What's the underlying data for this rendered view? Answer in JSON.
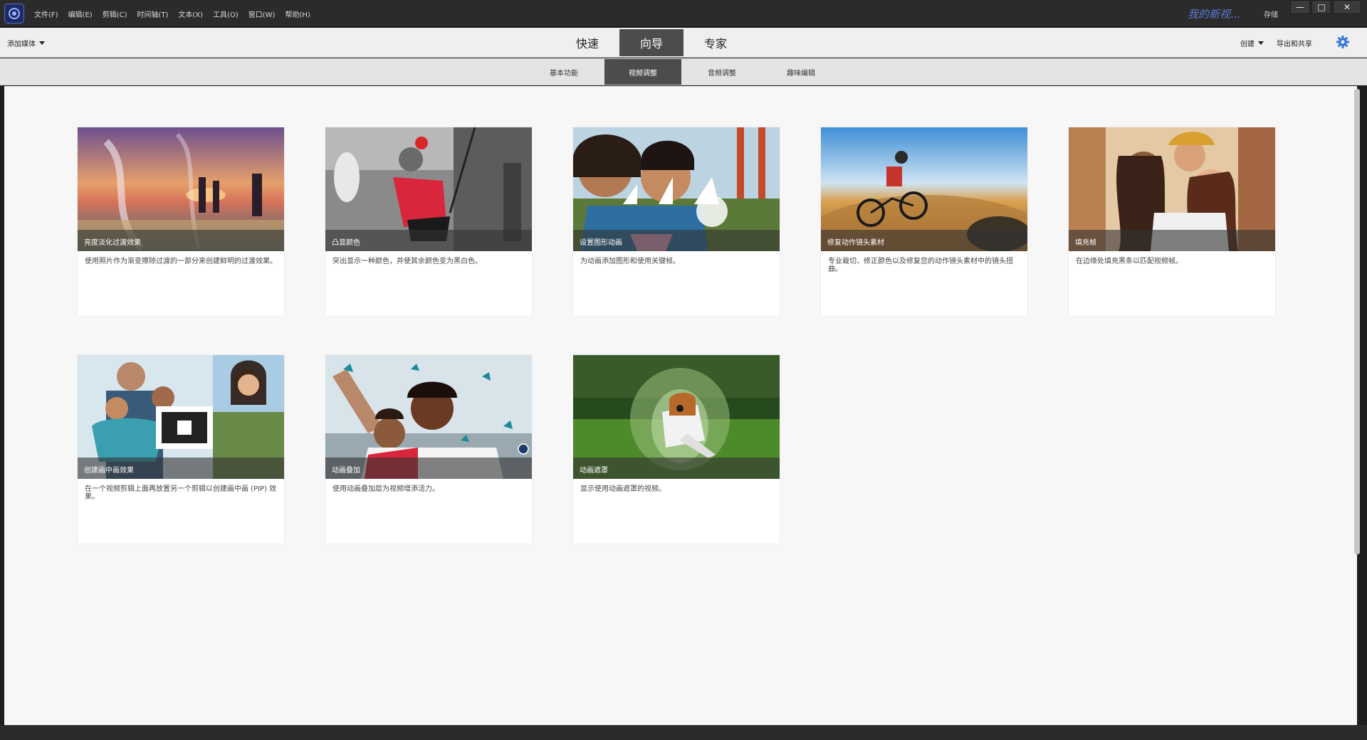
{
  "menu": {
    "items": [
      "文件(F)",
      "编辑(E)",
      "剪辑(C)",
      "时间轴(T)",
      "文本(X)",
      "工具(O)",
      "窗口(W)",
      "帮助(H)"
    ],
    "project_name": "我的新视...",
    "save": "存储"
  },
  "window_controls": {
    "minimize": "—",
    "maximize": "□",
    "close": "✕"
  },
  "modebar": {
    "add_media": "添加媒体",
    "tabs": [
      "快速",
      "向导",
      "专家"
    ],
    "active_tab": "向导",
    "create": "创建",
    "export": "导出和共享"
  },
  "subtabs": {
    "items": [
      "基本功能",
      "视频调整",
      "音频调整",
      "趣味编辑"
    ],
    "active": "视频调整"
  },
  "cards": [
    {
      "title": "亮度淡化过渡效果",
      "desc": "使用照片作为渐变擦除过渡的一部分来创建鲜明的过渡效果。"
    },
    {
      "title": "凸显颜色",
      "desc": "突出显示一种颜色，并使其余颜色变为黑白色。"
    },
    {
      "title": "设置图形动画",
      "desc": "为动画添加图形和使用关键帧。"
    },
    {
      "title": "修复动作镜头素材",
      "desc": "专业裁切、修正颜色以及修复您的动作镜头素材中的镜头扭曲。"
    },
    {
      "title": "填充帧",
      "desc": "在边缘处填充黑条以匹配视频帧。"
    },
    {
      "title": "创建画中画效果",
      "desc": "在一个视频剪辑上面再放置另一个剪辑以创建画中画 (PIP) 效果。"
    },
    {
      "title": "动画叠加",
      "desc": "使用动画叠加层为视频增添活力。"
    },
    {
      "title": "动画遮罩",
      "desc": "显示使用动画遮罩的视频。"
    }
  ],
  "colors": {
    "accent": "#4c4c4c",
    "project_name": "#5b7dd6",
    "gear": "#3a7bd5"
  },
  "icons": {
    "gear": "gear-icon",
    "logo": "app-logo-icon",
    "dropdown": "caret-down-icon"
  }
}
